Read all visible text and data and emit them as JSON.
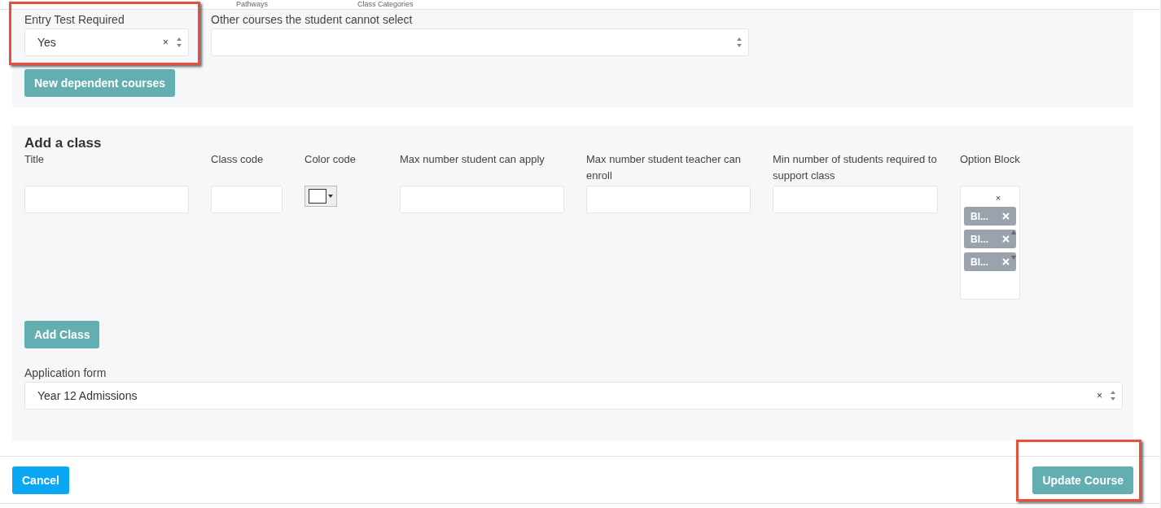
{
  "tabs": [
    {
      "label": "Pathways",
      "selected": false
    },
    {
      "label": "Class Categories",
      "selected": false
    }
  ],
  "dependencies": {
    "entry_test": {
      "label": "Entry Test Required",
      "value": "Yes",
      "clear": "×",
      "highlighted": true
    },
    "other_courses": {
      "label": "Other courses the student cannot select"
    },
    "button": "New dependent courses"
  },
  "add_class": {
    "heading": "Add a class",
    "columns": [
      {
        "label": "Title",
        "kind": "text"
      },
      {
        "label": "Class code",
        "kind": "text"
      },
      {
        "label": "Color code",
        "kind": "color"
      },
      {
        "label": "Max number student can apply",
        "kind": "text"
      },
      {
        "label": "Max number student teacher can enroll",
        "kind": "text"
      },
      {
        "label": "Min number of students required to support class",
        "kind": "text"
      },
      {
        "label": "Option Block",
        "kind": "multi"
      }
    ],
    "option_block": {
      "clear": "×",
      "tags": [
        "Bl...",
        "Bl...",
        "Bl..."
      ]
    },
    "button": "Add Class"
  },
  "application_form": {
    "label": "Application form",
    "value": "Year 12 Admissions",
    "clear": "×"
  },
  "footer": {
    "cancel": "Cancel",
    "update": "Update Course",
    "update_highlighted": true
  }
}
